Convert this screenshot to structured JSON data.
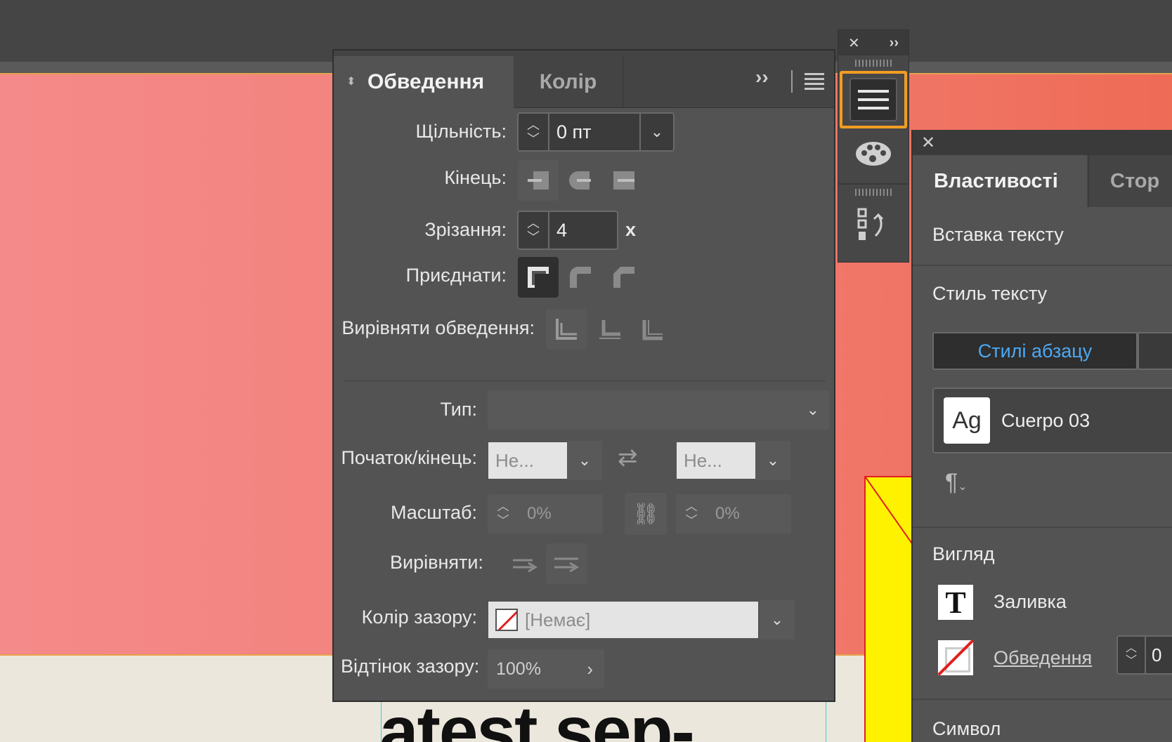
{
  "canvas": {
    "headline": "atest sep-"
  },
  "stroke_panel": {
    "tabs": [
      {
        "label": "Обведення"
      },
      {
        "label": "Колір"
      }
    ],
    "weight": {
      "label": "Щільність:",
      "value": "0 пт"
    },
    "cap": {
      "label": "Кінець:"
    },
    "miter": {
      "label": "Зрізання:",
      "value": "4",
      "suffix": "x"
    },
    "join": {
      "label": "Приєднати:"
    },
    "align_stroke": {
      "label": "Вирівняти обведення:"
    },
    "type": {
      "label": "Тип:",
      "value": ""
    },
    "start_end": {
      "label": "Початок/кінець:",
      "start_value": "Не...",
      "end_value": "Не..."
    },
    "scale": {
      "label": "Масштаб:",
      "start_value": "0%",
      "end_value": "0%"
    },
    "align": {
      "label": "Вирівняти:"
    },
    "gap_color": {
      "label": "Колір зазору:",
      "value": "[Немає]"
    },
    "gap_tint": {
      "label": "Відтінок зазору:",
      "value": "100%"
    }
  },
  "properties_panel": {
    "tabs": [
      {
        "label": "Властивості"
      },
      {
        "label": "Стор"
      }
    ],
    "text_insert": "Вставка тексту",
    "text_style": {
      "title": "Стиль тексту",
      "paragraph_styles_button": "Стилі абзацу",
      "current_style": "Cuerpo 03",
      "style_preview": "Ag"
    },
    "appearance": {
      "title": "Вигляд",
      "fill_label": "Заливка",
      "stroke_label": "Обведення",
      "stroke_weight": "0"
    },
    "character_title": "Символ"
  },
  "colors": {
    "accent_orange": "#f29d23",
    "link_blue": "#4ca9f5",
    "panel_bg": "#535353",
    "canvas_red": "#f27e74",
    "frame_yellow": "#fff200"
  }
}
